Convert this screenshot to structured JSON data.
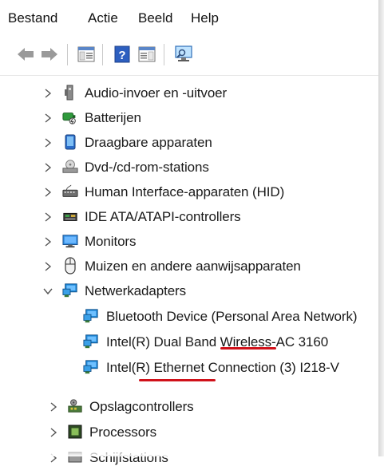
{
  "menu": [
    "Bestand",
    "Actie",
    "Beeld",
    "Help"
  ],
  "toolbar": {
    "back_icon": "arrow-left-icon",
    "forward_icon": "arrow-right-icon",
    "properties_icon": "console-tree-icon",
    "help_icon": "help-book-icon",
    "show_hide_icon": "action-pane-icon",
    "scan_icon": "monitor-scan-icon"
  },
  "tree": {
    "categories": [
      {
        "label": "Audio-invoer en -uitvoer",
        "icon": "speaker-icon",
        "expanded": false
      },
      {
        "label": "Batterijen",
        "icon": "battery-icon",
        "expanded": false
      },
      {
        "label": "Draagbare apparaten",
        "icon": "portable-device-icon",
        "expanded": false
      },
      {
        "label": "Dvd-/cd-rom-stations",
        "icon": "dvd-drive-icon",
        "expanded": false
      },
      {
        "label": "Human Interface-apparaten (HID)",
        "icon": "hid-icon",
        "expanded": false
      },
      {
        "label": "IDE ATA/ATAPI-controllers",
        "icon": "ide-controller-icon",
        "expanded": false
      },
      {
        "label": "Monitors",
        "icon": "monitor-icon",
        "expanded": false
      },
      {
        "label": "Muizen en andere aanwijsapparaten",
        "icon": "mouse-icon",
        "expanded": false
      },
      {
        "label": "Netwerkadapters",
        "icon": "network-adapter-icon",
        "expanded": true
      }
    ],
    "network_children": [
      {
        "label": "Bluetooth Device (Personal Area Network)",
        "icon": "network-adapter-icon"
      },
      {
        "label": "Intel(R) Dual Band Wireless-AC 3160",
        "icon": "network-adapter-icon"
      },
      {
        "label": "Intel(R) Ethernet Connection (3) I218-V",
        "icon": "network-adapter-icon"
      }
    ],
    "after": [
      {
        "label": "Opslagcontrollers",
        "icon": "storage-controller-icon",
        "expanded": false
      },
      {
        "label": "Processors",
        "icon": "processor-icon",
        "expanded": false
      },
      {
        "label": "Schijfstations",
        "icon": "disk-drive-icon",
        "expanded": false
      }
    ]
  },
  "colors": {
    "annotation_red": "#d0111a",
    "network_blue": "#1e88d8"
  }
}
